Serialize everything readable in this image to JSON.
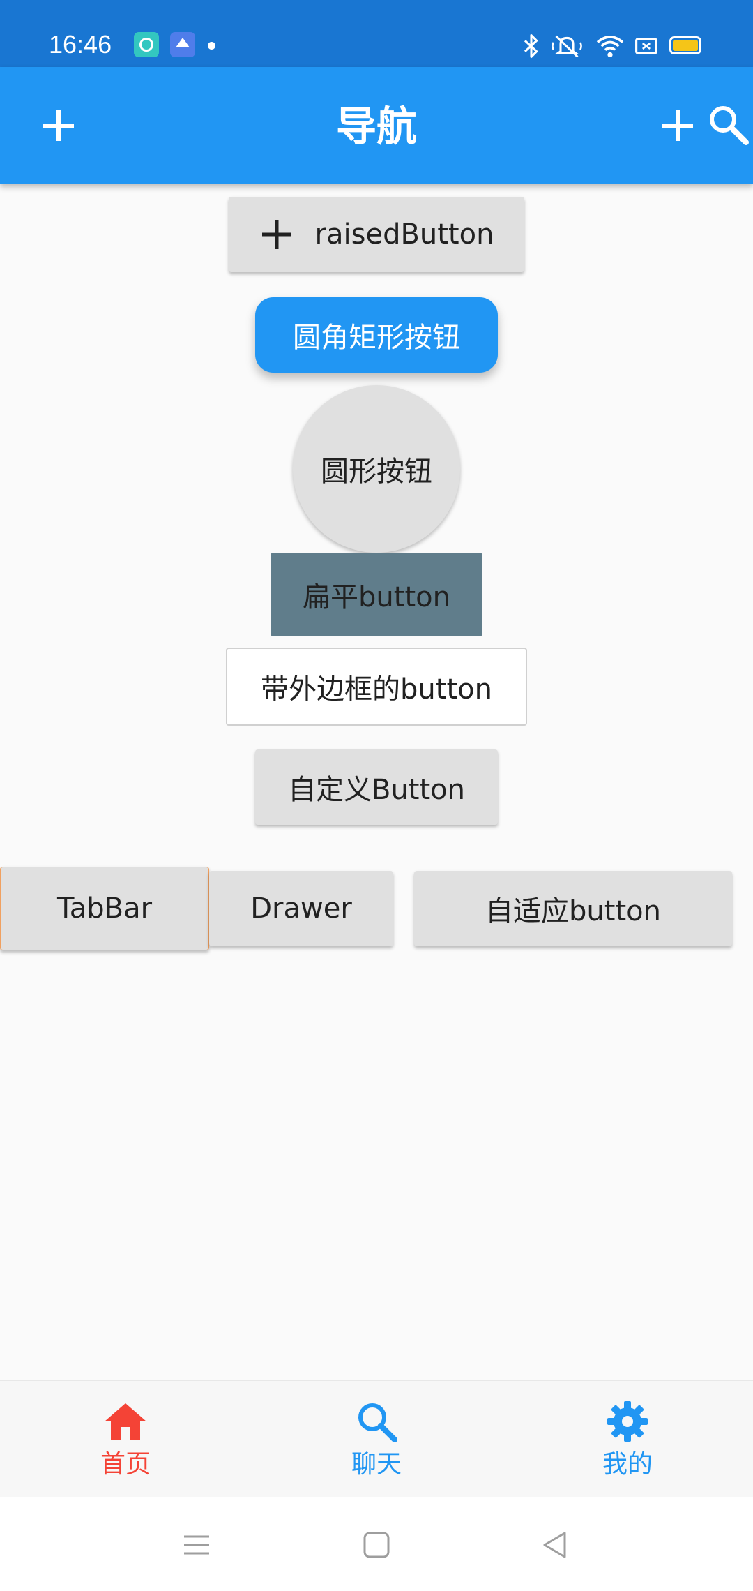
{
  "status_bar": {
    "time": "16:46",
    "notification_icons": [
      "app-notification-icon",
      "gallery-notification-icon",
      "notification-dot"
    ],
    "system_icons": [
      "bluetooth-icon",
      "mute-icon",
      "wifi-icon",
      "sim-icon",
      "battery-icon"
    ],
    "battery_color": "#f5c518",
    "background": "#1976d2"
  },
  "app_bar": {
    "title": "导航",
    "background": "#2196f3",
    "left_icon": "add-icon",
    "right_icons": [
      "add-icon",
      "search-icon"
    ]
  },
  "buttons": {
    "raised": "raisedButton",
    "rounded_rect": "圆角矩形按钮",
    "circle": "圆形按钮",
    "flat": "扁平button",
    "outlined": "带外边框的button",
    "custom": "自定义Button",
    "row": [
      "TabBar",
      "Drawer",
      "自适应button"
    ]
  },
  "bottom_nav": {
    "items": [
      {
        "label": "首页",
        "icon": "home-icon",
        "color": "#f44336",
        "active": true
      },
      {
        "label": "聊天",
        "icon": "search-icon",
        "color": "#2196f3",
        "active": false
      },
      {
        "label": "我的",
        "icon": "settings-icon",
        "color": "#2196f3",
        "active": false
      }
    ]
  },
  "system_nav": {
    "buttons": [
      "menu-icon",
      "home-square-icon",
      "back-triangle-icon"
    ]
  }
}
